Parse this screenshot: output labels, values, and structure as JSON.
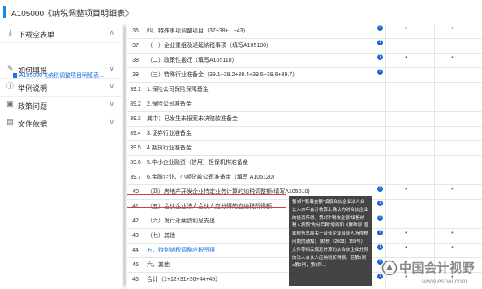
{
  "header": {
    "title": "A105000《纳税调整项目明细表》"
  },
  "sidebar": {
    "items": [
      {
        "label": "下载空表单",
        "icon": "download-icon",
        "open": true
      },
      {
        "label": "如何填报",
        "icon": "pencil-icon"
      },
      {
        "label": "举例说明",
        "icon": "info-icon"
      },
      {
        "label": "政策问题",
        "icon": "folder-icon"
      },
      {
        "label": "文件依据",
        "icon": "document-icon"
      }
    ],
    "sub_item": "A105000《纳税调整项目明细表...",
    "sub_icon": "pdf-icon"
  },
  "table": {
    "rows": [
      {
        "num": "36",
        "text": "四、特殊事项调整项目（37+38+...+43）",
        "help": true,
        "s1": "*",
        "s2": "*"
      },
      {
        "num": "37",
        "text": "（一）企业重组及递延纳税事项（填写A105100）",
        "help": true,
        "s1": "",
        "s2": ""
      },
      {
        "num": "38",
        "text": "（二）政策性搬迁（填写A105110）",
        "help": true,
        "s1": "*",
        "s2": "*"
      },
      {
        "num": "39",
        "text": "（三）特殊行业准备金（39.1+39.2+39.4+39.5+39.6+39.7）",
        "help": true,
        "s1": "",
        "s2": ""
      },
      {
        "num": "39.1",
        "text": "1.保险公司保险保障基金",
        "help": false,
        "s1": "",
        "s2": ""
      },
      {
        "num": "39.2",
        "text": "2.保险公司准备金",
        "help": false,
        "s1": "",
        "s2": ""
      },
      {
        "num": "39.3",
        "text": "其中：已发生未报案未决赔款准备金",
        "help": false,
        "s1": "",
        "s2": ""
      },
      {
        "num": "39.4",
        "text": "3.证券行业准备金",
        "help": false,
        "s1": "",
        "s2": ""
      },
      {
        "num": "39.5",
        "text": "4.期货行业准备金",
        "help": false,
        "s1": "",
        "s2": ""
      },
      {
        "num": "39.6",
        "text": "5.中小企业融资（信用）担保机构准备金",
        "help": false,
        "s1": "",
        "s2": ""
      },
      {
        "num": "39.7",
        "text": "6.金融企业、小额贷款公司准备金（填写 A105120）",
        "help": false,
        "s1": "",
        "s2": ""
      },
      {
        "num": "40",
        "text": "（四）房地产开发企业特定业务计算的纳税调整额(填写A105010)",
        "help": true,
        "s1": "*",
        "s2": "*"
      },
      {
        "num": "41",
        "text": "（五）合伙企业法人合伙人应分得的应纳税所得额",
        "help": true,
        "s1": "",
        "s2": ""
      },
      {
        "num": "42",
        "text": "（六）发行永续债利息支出",
        "help": true,
        "s1": "",
        "s2": ""
      },
      {
        "num": "43",
        "text": "（七）其他",
        "help": true,
        "s1": "*",
        "s2": "*"
      },
      {
        "num": "44",
        "text": "五、特别纳税调整应税所得",
        "help": true,
        "s1": "*",
        "s2": "*",
        "blue": true
      },
      {
        "num": "45",
        "text": "六、其他",
        "help": true,
        "s1": "*",
        "s2": "*"
      },
      {
        "num": "46",
        "text": "合计（1+12+31+36+44+45）",
        "help": true,
        "s1": "*",
        "s2": "*"
      }
    ]
  },
  "tooltip": {
    "text": "第1列“账载金额”填报合伙企业法人合伙人本年会计核算上确认的对合伙企业的投资所得。第2列“税收金额”填报纳税人按照“先分后税”原则和《财政部 国家税务总局关于合伙企业合伙人所得税问题的通知》（财税〔2008〕159号）文件等相关规定计算的从合伙企业分得的法人合伙人应纳税所得额。若第1列≤第2列，第3列…"
  },
  "watermark": {
    "text_cn": "中国会计视野",
    "url": "www.esnai.com"
  }
}
